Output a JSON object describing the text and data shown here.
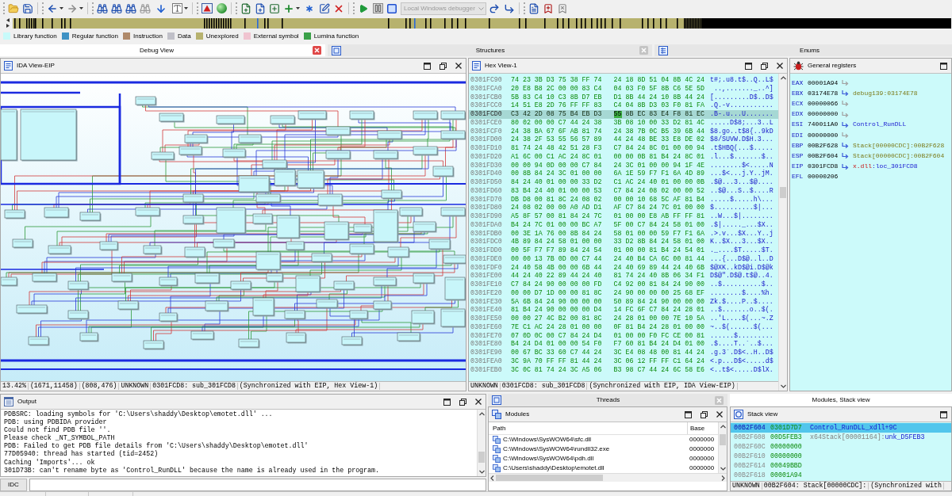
{
  "toolbar": {
    "debugger": {
      "value": "Local Windows debugger",
      "disabled": true
    }
  },
  "legend": [
    {
      "label": "Library function",
      "color": "#c8fafa"
    },
    {
      "label": "Regular function",
      "color": "#3f92c4"
    },
    {
      "label": "Instruction",
      "color": "#b08a6a"
    },
    {
      "label": "Data",
      "color": "#c0c0c8"
    },
    {
      "label": "Unexplored",
      "color": "#b7b26e"
    },
    {
      "label": "External symbol",
      "color": "#f0c4d0"
    },
    {
      "label": "Lumina function",
      "color": "#3aa048"
    }
  ],
  "top_tabs": [
    {
      "label": "Debug View",
      "selected": true,
      "closable": true
    },
    {
      "label": "Structures",
      "selected": false,
      "closable": true
    },
    {
      "label": "Enums",
      "selected": false,
      "closable": false
    }
  ],
  "ida_view": {
    "title": "IDA View-EIP",
    "status": [
      "13.42%",
      "(1671,11458)",
      "(808,476)",
      "UNKNOWN",
      "0301FCD8: sub_301FCD8",
      "(Synchronized with EIP, Hex View-1)"
    ]
  },
  "hex_view": {
    "title": "Hex View-1",
    "rows": [
      {
        "address": "0301FC90",
        "left": "74 23 3B D3 75 38 FF 74",
        "right": "24 18 8D 51 04 8B 4C 24",
        "ascii": "t#;.u8.t$..Q..L$",
        "selected": false
      },
      {
        "address": "0301FCA0",
        "left": "20 E8 B8 2C 00 00 83 C4",
        "right": "04 03 F0 5F 8B C6 5E 5D",
        "ascii": " ..,......._..^]",
        "selected": false
      },
      {
        "address": "0301FCB0",
        "left": "5B 83 C4 10 C3 8B D7 EB",
        "right": "D1 8B 44 24 10 8B 44 24",
        "ascii": "[.........D$..D$",
        "selected": false
      },
      {
        "address": "0301FCC0",
        "left": "14 51 E8 2D 76 FF FF 83",
        "right": "C4 04 8B D3 03 F0 81 FA",
        "ascii": ".Q.-v...........",
        "selected": false
      },
      {
        "address": "0301FCD0",
        "left": "C3 42 2D 08 75 B4 EB D3",
        "cursor": "55",
        "right": "8B EC 83 E4 F8 81 EC",
        "ascii": ".B-.u...U.......",
        "selected": true
      },
      {
        "address": "0301FCE0",
        "left": "80 02 00 00 C7 44 24 38",
        "right": "3B 08 10 00 33 D2 81 4C",
        "ascii": ".....D$8;...3..L",
        "selected": false
      },
      {
        "address": "0301FCF0",
        "left": "24 38 BA 67 6F AB 81 74",
        "right": "24 38 7B 0C B5 39 6B 44",
        "ascii": "$8.go..t$8{..9kD",
        "selected": false
      },
      {
        "address": "0301FD00",
        "left": "24 38 2F 53 55 56 57 89",
        "right": "44 24 48 BE 33 E8 DE 02",
        "ascii": "$8/SUVW.D$H.3...",
        "selected": false
      },
      {
        "address": "0301FD10",
        "left": "81 74 24 48 42 51 28 F3",
        "right": "C7 84 24 8C 01 00 00 94",
        "ascii": ".t$HBQ(...$.....",
        "selected": false
      },
      {
        "address": "0301FD20",
        "left": "A1 6C 00 C1 AC 24 8C 01",
        "right": "00 00 0B 81 B4 24 8C 01",
        "ascii": ".l...$.......$..",
        "selected": false
      },
      {
        "address": "0301FD30",
        "left": "00 00 94 0D 00 00 C7 84",
        "right": "24 3C 01 00 00 94 1F 4E",
        "ascii": "........$<.....N",
        "selected": false
      },
      {
        "address": "0301FD40",
        "left": "00 8B 84 24 3C 01 00 00",
        "right": "6A 1E 59 F7 F1 6A 4D 89",
        "ascii": "...$<...j.Y..jM.",
        "selected": false
      },
      {
        "address": "0301FD50",
        "left": "84 24 40 01 00 00 33 D2",
        "right": "C1 AC 24 40 01 00 00 0B",
        "ascii": ".$@...3...$@....",
        "selected": false
      },
      {
        "address": "0301FD60",
        "left": "83 B4 24 40 01 00 00 53",
        "right": "C7 84 24 08 02 00 00 52",
        "ascii": "..$@...S..$....R",
        "selected": false
      },
      {
        "address": "0301FD70",
        "left": "DB D8 00 81 8C 24 08 02",
        "right": "00 00 10 68 5C AF 81 B4",
        "ascii": ".....$.....h\\...",
        "selected": false
      },
      {
        "address": "0301FD80",
        "left": "24 08 02 00 00 A0 AD D1",
        "right": "AF C7 84 24 7C 01 00 00",
        "ascii": "$..........$|...",
        "selected": false
      },
      {
        "address": "0301FD90",
        "left": "A5 8F 57 00 81 84 24 7C",
        "right": "01 00 00 E8 AB FF FF 81",
        "ascii": "..W...$|........",
        "selected": false
      },
      {
        "address": "0301FDA0",
        "left": "B4 24 7C 01 00 00 BC A7",
        "right": "5F 00 C7 84 24 58 01 00",
        "ascii": ".$|....._...$X..",
        "selected": false
      },
      {
        "address": "0301FDB0",
        "left": "00 3E 1A 76 00 8B 84 24",
        "right": "58 01 00 00 59 F7 F1 6A",
        "ascii": ".>.v...$X...Y..j",
        "selected": false
      },
      {
        "address": "0301FDC0",
        "left": "4B 89 84 24 58 01 00 00",
        "right": "33 D2 8B 84 24 58 01 00",
        "ascii": "K..$X...3...$X..",
        "selected": false
      },
      {
        "address": "0301FDD0",
        "left": "00 5F F7 F7 89 84 24 54",
        "right": "01 00 00 81 B4 24 54 01",
        "ascii": "._....$T.....$T.",
        "selected": false
      },
      {
        "address": "0301FDE0",
        "left": "00 00 13 7B 0D 00 C7 44",
        "right": "24 40 B4 CA 6C 00 81 44",
        "ascii": "...{...D$@..l..D",
        "selected": false
      },
      {
        "address": "0301FDF0",
        "left": "24 40 58 4B 00 00 6B 44",
        "right": "24 40 69 89 44 24 40 6B",
        "ascii": "$@XK..kD$@i.D$@k",
        "selected": false
      },
      {
        "address": "0301FE00",
        "left": "44 24 40 22 89 44 24 40",
        "right": "81 74 24 40 8B 06 34 F1",
        "ascii": "D$@\".D$@.t$@..4.",
        "selected": false
      },
      {
        "address": "0301FE10",
        "left": "C7 84 24 90 00 00 00 FD",
        "right": "C4 92 00 81 84 24 90 00",
        "ascii": "..$..........$..",
        "selected": false
      },
      {
        "address": "0301FE20",
        "left": "00 00 D7 1D 00 00 81 8C",
        "right": "24 90 00 00 00 25 68 EF",
        "ascii": "........$....%h.",
        "selected": false
      },
      {
        "address": "0301FE30",
        "left": "5A 6B 84 24 90 00 00 00",
        "right": "50 89 84 24 90 00 00 00",
        "ascii": "Zk.$....P..$....",
        "selected": false
      },
      {
        "address": "0301FE40",
        "left": "81 B4 24 90 00 00 00 D4",
        "right": "14 FC 6F C7 84 24 28 01",
        "ascii": "..$.......o..$(.",
        "selected": false
      },
      {
        "address": "0301FE50",
        "left": "00 00 27 4C B2 00 81 8C",
        "right": "24 28 01 00 00 7E 10 5A",
        "ascii": "..'L....$(...~.Z",
        "selected": false
      },
      {
        "address": "0301FE60",
        "left": "7E C1 AC 24 28 01 00 00",
        "right": "0F 81 B4 24 28 01 00 00",
        "ascii": "~..$(......$(...",
        "selected": false
      },
      {
        "address": "0301FE70",
        "left": "07 0D 0C 00 C7 84 24 D4",
        "right": "01 00 00 F0 FC CE 00 81",
        "ascii": "......$.........",
        "selected": false
      },
      {
        "address": "0301FE80",
        "left": "B4 24 D4 01 00 00 54 F0",
        "right": "F7 60 81 B4 24 D4 01 00",
        "ascii": ".$....T..`..$...",
        "selected": false
      },
      {
        "address": "0301FE90",
        "left": "00 67 BC 33 60 C7 44 24",
        "right": "3C E4 08 48 00 81 44 24",
        "ascii": ".g.3`.D$<..H..D$",
        "selected": false
      },
      {
        "address": "0301FEA0",
        "left": "3C 9A 70 FF FF 81 44 24",
        "right": "3C 06 12 FF FF C1 64 24",
        "ascii": "<.p...D$<.....d$",
        "selected": false
      },
      {
        "address": "0301FEB0",
        "left": "3C 0C 81 74 24 3C A5 06",
        "right": "B3 98 C7 44 24 6C 58 E6",
        "ascii": "<..t$<.....D$lX.",
        "selected": false
      }
    ],
    "status": [
      "UNKNOWN",
      "0301FCD8: sub_301FCD8",
      "(Synchronized with EIP, IDA View-EIP)"
    ]
  },
  "registers": {
    "title": "General registers",
    "rows": [
      {
        "name": "EAX",
        "value": "00001A94",
        "kind": "general"
      },
      {
        "name": "EBX",
        "value": "03174E78",
        "kind": "general",
        "target": [
          {
            "text": "debug139:03174E78",
            "kind": "data"
          }
        ]
      },
      {
        "name": "ECX",
        "value": "00000066",
        "kind": "general"
      },
      {
        "name": "EDX",
        "value": "00000000",
        "kind": "general"
      },
      {
        "name": "ESI",
        "value": "740011A0",
        "kind": "general",
        "target": [
          {
            "text": "Control_RunDLL",
            "kind": "code"
          }
        ]
      },
      {
        "name": "EDI",
        "value": "00000000",
        "kind": "general"
      },
      {
        "name": "EBP",
        "value": "00B2F628",
        "kind": "general",
        "target": [
          {
            "text": "Stack[00000CDC]:00B2F628",
            "kind": "data"
          }
        ]
      },
      {
        "name": "ESP",
        "value": "00B2F604",
        "kind": "general",
        "target": [
          {
            "text": "Stack[00000CDC]:00B2F604",
            "kind": "data"
          }
        ]
      },
      {
        "name": "EIP",
        "value": "0301FCD8",
        "kind": "general",
        "target": [
          {
            "text": "x.dll",
            "kind": "segment"
          },
          {
            "text": ":loc_301FCD8",
            "kind": "code"
          }
        ]
      },
      {
        "name": "EFL",
        "value": "00000206",
        "kind": "flags"
      }
    ]
  },
  "output": {
    "title": "Output",
    "lines": [
      "PDBSRC: loading symbols for 'C:\\Users\\shaddy\\Desktop\\emotet.dll' ...",
      "PDB: using PDBIDA provider",
      "Could not find PDB file ''.",
      "Please check _NT_SYMBOL_PATH",
      "PDB: Failed to get PDB file details from 'C:\\Users\\shaddy\\Desktop\\emotet.dll'",
      "77D05940: thread has started (tid=2452)",
      "Caching 'Imports'... ok",
      "301D73B: can't rename byte as 'Control_RunDLL' because the name is already used in the program."
    ]
  },
  "command_line": {
    "language": "IDC"
  },
  "bottom_tabs": [
    {
      "label": "Threads",
      "selected": false,
      "closable": true
    },
    {
      "label": "Modules, Stack view",
      "selected": true,
      "closable": false
    }
  ],
  "modules": {
    "title": "Modules",
    "columns": [
      "Path",
      "Base"
    ],
    "rows": [
      {
        "path": "C:\\Windows\\SysWOW64\\sfc.dll",
        "base": "0000000"
      },
      {
        "path": "C:\\Windows\\SysWOW64\\rundll32.exe",
        "base": "0000000"
      },
      {
        "path": "C:\\Windows\\SysWOW64\\pdh.dll",
        "base": "0000000"
      },
      {
        "path": "C:\\Users\\shaddy\\Desktop\\emotet.dll",
        "base": "0000000"
      }
    ]
  },
  "stack_view": {
    "title": "Stack view",
    "rows": [
      {
        "address": "00B2F604",
        "value": "0301D7D7",
        "label": [
          {
            "text": "Control_RunDLL_xdll+9C",
            "kind": "code"
          }
        ],
        "selected": true
      },
      {
        "address": "00B2F608",
        "value": "00D5FEB3",
        "label": [
          {
            "text": "x64Stack[00001164]:",
            "kind": "stack"
          },
          {
            "text": "unk_D5FEB3",
            "kind": "code"
          }
        ],
        "selected": false
      },
      {
        "address": "00B2F60C",
        "value": "00000000",
        "selected": false
      },
      {
        "address": "00B2F610",
        "value": "00000000",
        "selected": false
      },
      {
        "address": "00B2F614",
        "value": "00049BBD",
        "selected": false
      },
      {
        "address": "00B2F618",
        "value": "00001A94",
        "selected": false
      }
    ],
    "status": [
      "UNKNOWN",
      "00B2F604: Stack[00000CDC]:",
      "(Synchronized with"
    ]
  }
}
